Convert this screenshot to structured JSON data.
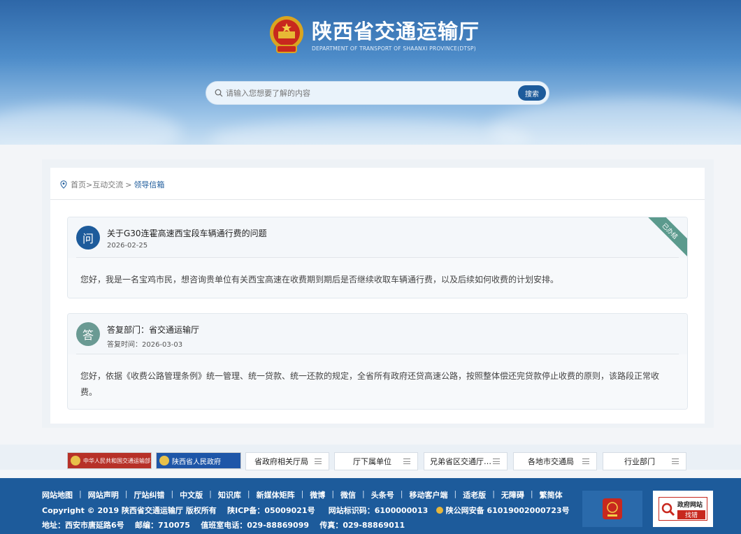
{
  "header": {
    "title": "陕西省交通运输厅",
    "subtitle": "DEPARTMENT OF TRANSPORT OF SHAANXI PROVINCE(DTSP)"
  },
  "search": {
    "placeholder": "请输入您想要了解的内容",
    "button": "搜索"
  },
  "breadcrumb": {
    "home": "首页",
    "sep1": ">",
    "section": "互动交流",
    "sep2": ">",
    "current": "领导信箱"
  },
  "question": {
    "badge": "问",
    "title": "关于G30连霍高速西宝段车辆通行费的问题",
    "date": "2026-02-25",
    "status": "已办结",
    "body": "您好，我是一名宝鸡市民，想咨询贵单位有关西宝高速在收费期到期后是否继续收取车辆通行费，以及后续如何收费的计划安排。"
  },
  "answer": {
    "badge": "答",
    "dept": "答复部门：省交通运输厅",
    "date": "答复时间：2026-03-03",
    "body": "您好，依据《收费公路管理条例》统一管理、统一贷款、统一还款的规定，全省所有政府还贷高速公路，按照整体偿还完贷款停止收费的原则，该路段正常收费。"
  },
  "linkbar": {
    "ministry": "中华人民共和国交通运输部",
    "province": "陕西省人民政府",
    "selects": [
      "省政府相关厅局",
      "厅下属单位",
      "兄弟省区交通厅…",
      "各地市交通局",
      "行业部门"
    ]
  },
  "footer": {
    "links": [
      "网站地图",
      "网站声明",
      "厅站纠错",
      "中文版",
      "知识库",
      "新媒体矩阵",
      "微博",
      "微信",
      "头条号",
      "移动客户端",
      "适老版",
      "无障碍",
      "繁简体"
    ],
    "copyright": "Copyright © 2019 陕西省交通运输厅 版权所有",
    "icp": "陕ICP备：05009021号",
    "site_id": "网站标识码：6100000013",
    "police": "陕公网安备 61019002000723号",
    "address": "地址：西安市唐延路6号",
    "zip": "邮编：710075",
    "duty_phone": "值班室电话：029-88869099",
    "fax": "传真：029-88869011",
    "badge2_line1": "政府网站",
    "badge2_line2": "找错"
  },
  "colors": {
    "primary": "#1d5b9b",
    "answer_badge": "#6a9a93",
    "ribbon": "#5b9a8d"
  }
}
